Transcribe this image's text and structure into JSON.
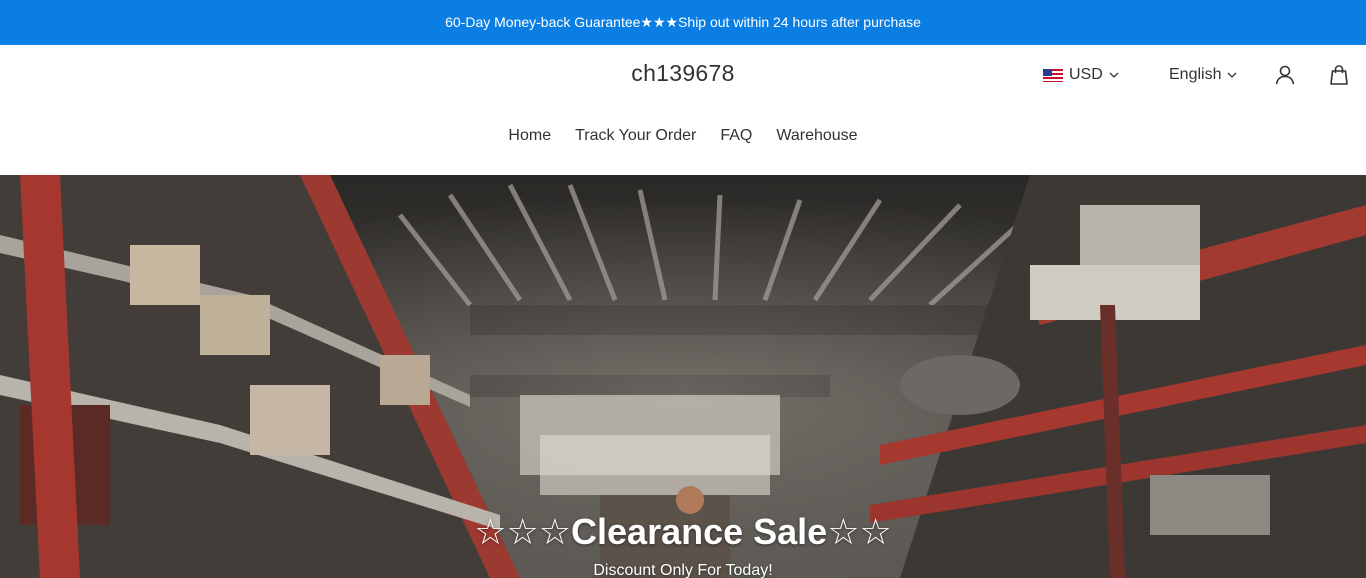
{
  "announcement": {
    "text": "60-Day Money-back Guarantee★★★Ship out within 24 hours after purchase"
  },
  "header": {
    "logo": "ch139678",
    "currency": {
      "label": "USD",
      "flag_icon": "us-flag-icon"
    },
    "language": {
      "label": "English"
    },
    "icons": [
      "user-icon",
      "cart-bag-icon"
    ]
  },
  "nav": {
    "items": [
      {
        "label": "Home"
      },
      {
        "label": "Track Your Order"
      },
      {
        "label": "FAQ"
      },
      {
        "label": "Warehouse"
      }
    ]
  },
  "hero": {
    "title": "☆☆☆Clearance Sale☆☆",
    "subtitle": "Discount Only For Today!"
  },
  "colors": {
    "announcement_bg": "#0a7ee3",
    "text": "#333333"
  }
}
